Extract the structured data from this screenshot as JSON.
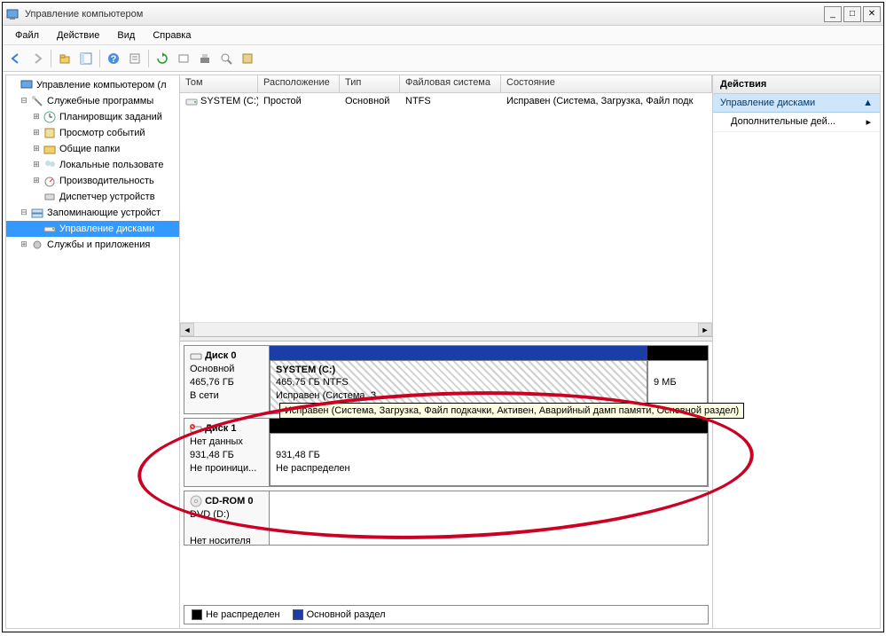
{
  "window": {
    "title": "Управление компьютером"
  },
  "menu": {
    "file": "Файл",
    "action": "Действие",
    "view": "Вид",
    "help": "Справка"
  },
  "tree": {
    "root": "Управление компьютером (л",
    "svc": "Служебные программы",
    "scheduler": "Планировщик заданий",
    "eventvwr": "Просмотр событий",
    "shared": "Общие папки",
    "users": "Локальные пользовате",
    "perf": "Производительность",
    "devmgr": "Диспетчер устройств",
    "storage": "Запоминающие устройст",
    "diskmgmt": "Управление дисками",
    "apps": "Службы и приложения"
  },
  "cols": {
    "vol": "Том",
    "layout": "Расположение",
    "type": "Тип",
    "fs": "Файловая система",
    "status": "Состояние"
  },
  "row0": {
    "vol": "SYSTEM (C:)",
    "layout": "Простой",
    "type": "Основной",
    "fs": "NTFS",
    "status": "Исправен (Система, Загрузка, Файл подк"
  },
  "disk0": {
    "title": "Диск 0",
    "kind": "Основной",
    "size": "465,76 ГБ",
    "state": "В сети",
    "v0name": "SYSTEM  (C:)",
    "v0fs": "465,75 ГБ NTFS",
    "v0stat": "Исправен (Система, З",
    "v1size": "9 МБ"
  },
  "disk1": {
    "title": "Диск 1",
    "kind": "Нет данных",
    "size": "931,48 ГБ",
    "state": "Не проиници...",
    "v0size": "931,48 ГБ",
    "v0stat": "Не распределен"
  },
  "cdrom": {
    "title": "CD-ROM 0",
    "kind": "DVD (D:)",
    "state": "Нет носителя"
  },
  "legend": {
    "unalloc": "Не распределен",
    "primary": "Основной раздел"
  },
  "tooltip": "Исправен (Система, Загрузка, Файл подкачки, Активен, Аварийный дамп памяти, Основной раздел)",
  "actions": {
    "title": "Действия",
    "section": "Управление дисками",
    "more": "Дополнительные дей..."
  },
  "colors": {
    "primary": "#1a3ea8",
    "black": "#000000"
  }
}
